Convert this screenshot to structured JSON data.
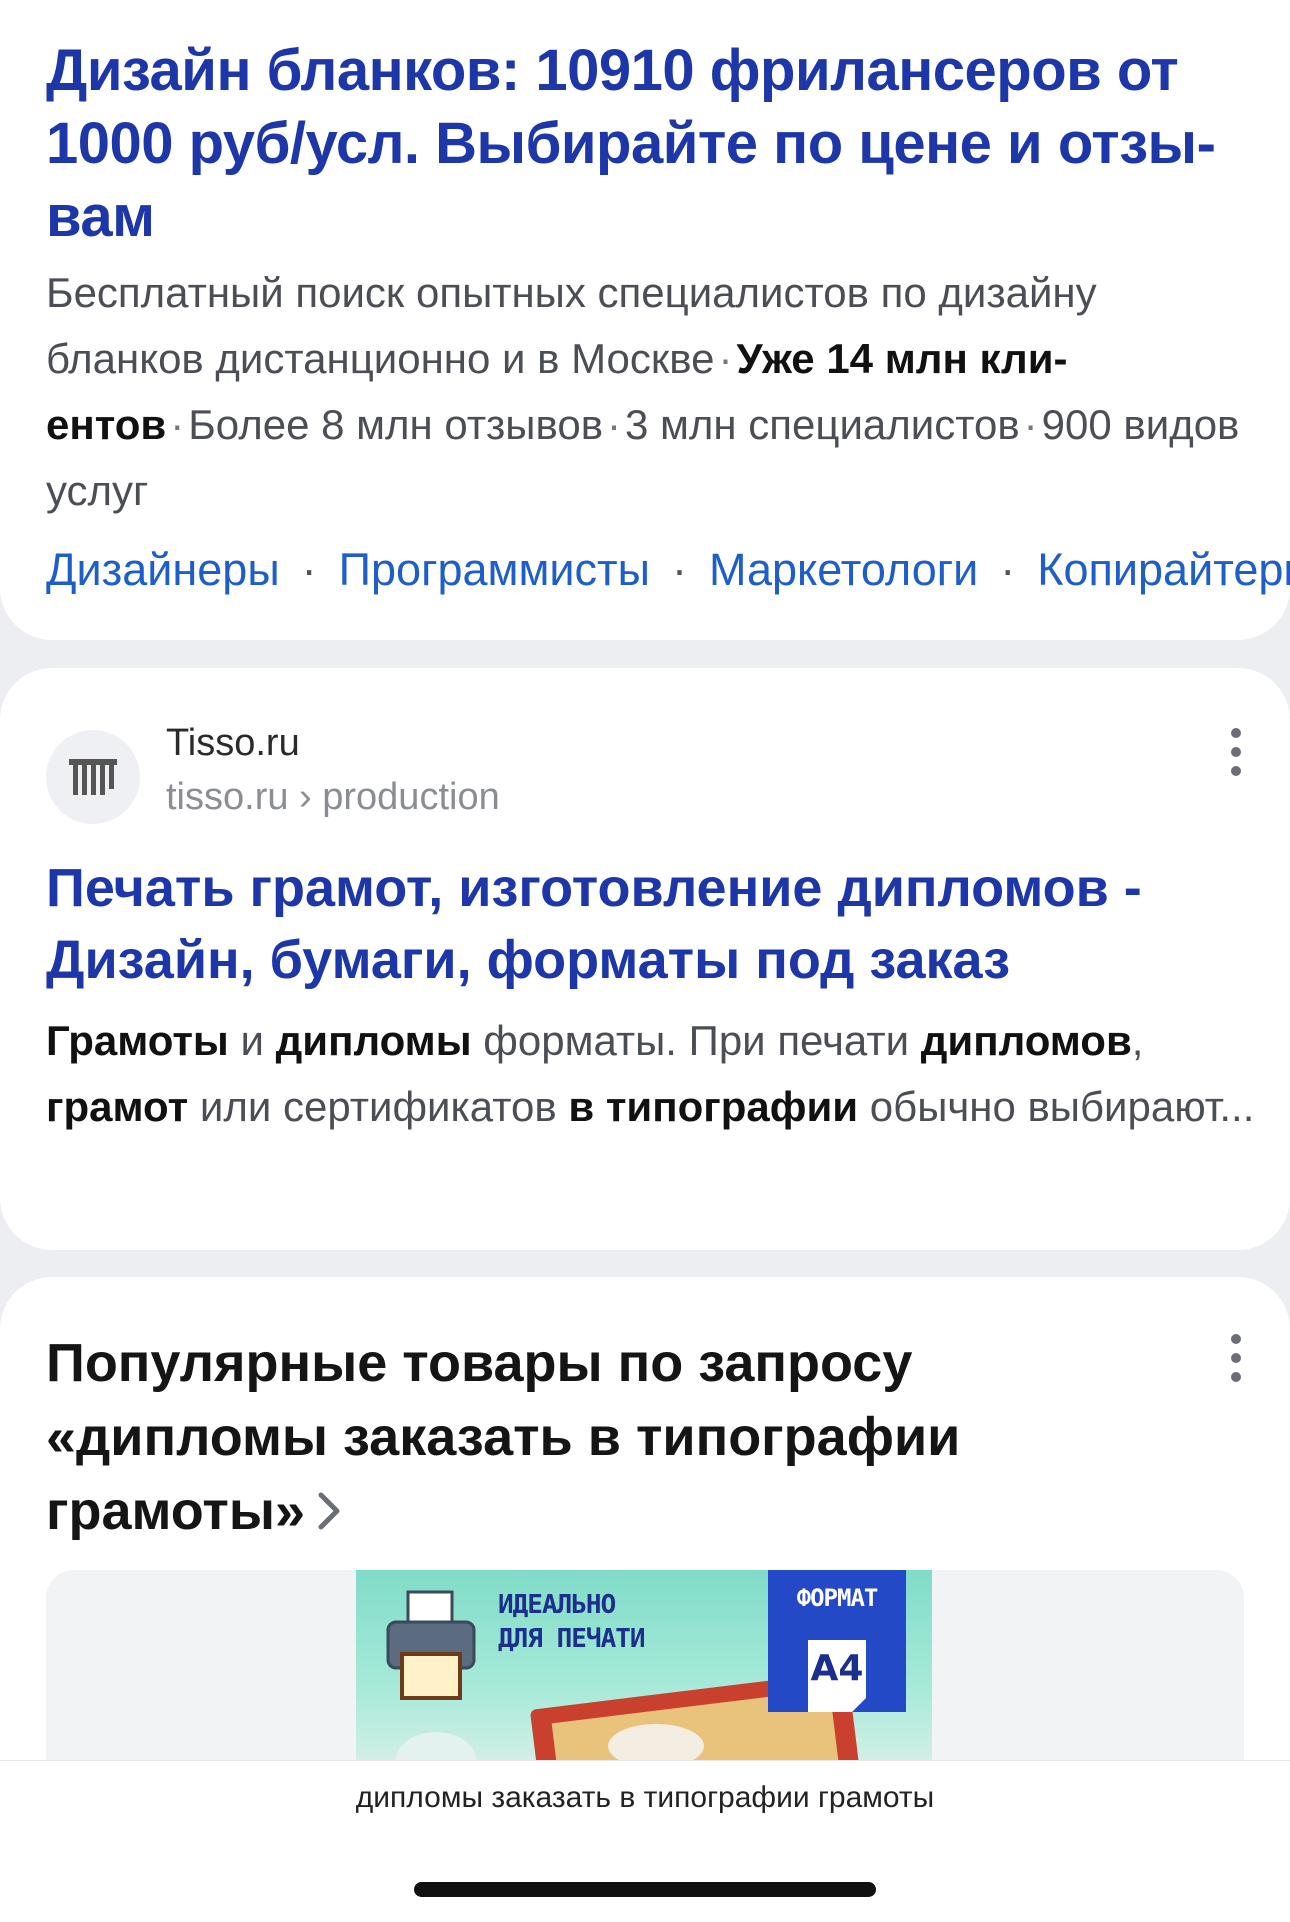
{
  "ad": {
    "title": "Дизайн бланков: 10910 фрилансеров от 1000 руб/усл. Выбирайте по цене и отзы­вам",
    "desc_1": "Бесплатный поиск опытных специалистов по дизайну бланков дистанционно и в Москве",
    "desc_bold": "Уже 14 млн кли­ентов",
    "desc_2": "Более 8 млн отзывов",
    "desc_3": "3 млн специалистов",
    "desc_4": "900 видов услуг",
    "sitelinks": [
      "Дизайнеры",
      "Программисты",
      "Маркетологи",
      "Копирайтеры"
    ]
  },
  "result": {
    "site_name": "Tisso.ru",
    "site_url": "tisso.ru › production",
    "title": "Печать грамот, изготовление дипломов - Дизайн, бумаги, форматы под заказ",
    "snippet": {
      "b1": "Грамоты",
      "t1": " и ",
      "b2": "дипломы",
      "t2": " форматы. При печати ",
      "b3": "дипломов",
      "t3": ",",
      "b4": "грамот",
      "t4": " или сертификатов ",
      "b5": "в типографии",
      "t5": " обычно вы­бирают..."
    }
  },
  "popular": {
    "title": "Популярные товары по запросу «дипломы заказать в типографии грамоты»",
    "product": {
      "banner_line1": "ИДЕАЛЬНО",
      "banner_line2": "ДЛЯ ПЕЧАТИ",
      "format_label": "ФОРМАТ",
      "format_value": "A4"
    }
  },
  "bottom": {
    "query": "дипломы заказать в типографии грамоты"
  },
  "colors": {
    "link_title": "#1d36a8",
    "sitelink": "#1d5ec9",
    "format_badge": "#2449c7"
  }
}
